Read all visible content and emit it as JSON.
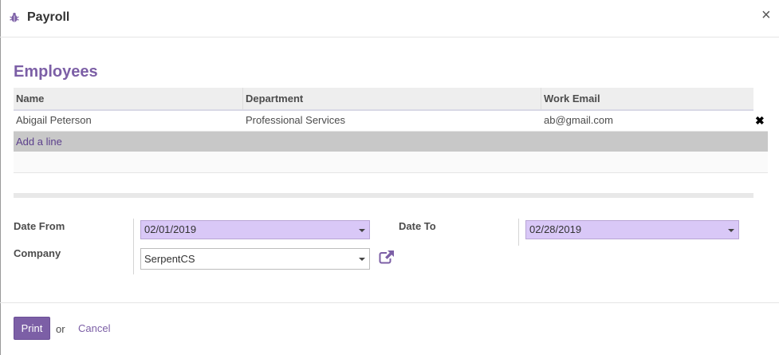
{
  "dialog": {
    "title": "Payroll",
    "close_glyph": "×",
    "icon": "bug-icon"
  },
  "employees": {
    "section_title": "Employees",
    "columns": [
      "Name",
      "Department",
      "Work Email"
    ],
    "rows": [
      {
        "name": "Abigail Peterson",
        "department": "Professional Services",
        "work_email": "ab@gmail.com"
      }
    ],
    "delete_glyph": "✖",
    "add_line_label": "Add a line"
  },
  "form": {
    "date_from_label": "Date From",
    "date_from_value": "02/01/2019",
    "date_to_label": "Date To",
    "date_to_value": "02/28/2019",
    "company_label": "Company",
    "company_value": "SerpentCS",
    "external_link_icon": "external-link-icon"
  },
  "footer": {
    "print_label": "Print",
    "or_text": "or",
    "cancel_label": "Cancel"
  },
  "colors": {
    "accent": "#7c5fa6",
    "required_field_bg": "#d9c8f7"
  }
}
